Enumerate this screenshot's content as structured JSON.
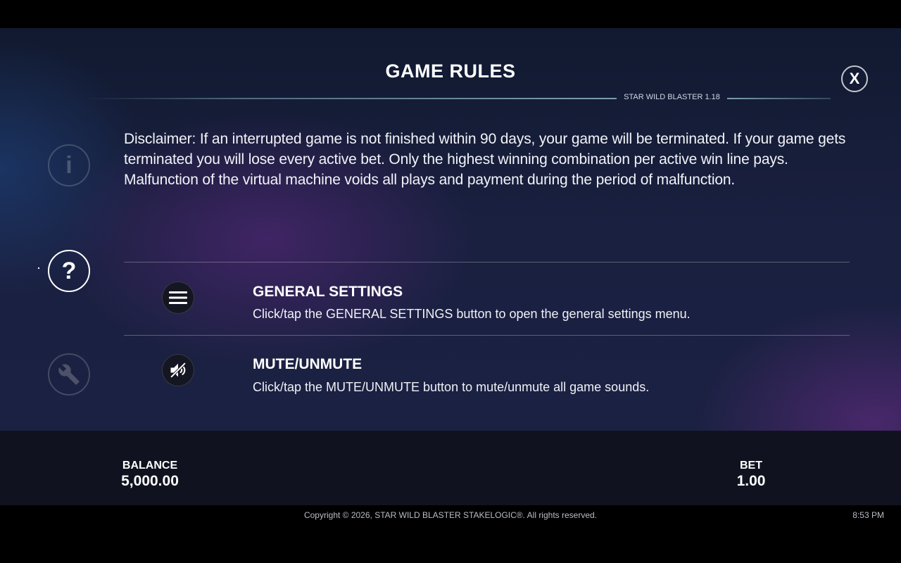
{
  "header": {
    "title": "GAME RULES",
    "version": "STAR WILD BLASTER 1.18",
    "close_label": "X"
  },
  "sidebar": {
    "items": [
      {
        "name": "info",
        "glyph": "i",
        "active": false
      },
      {
        "name": "help",
        "glyph": "?",
        "active": true
      },
      {
        "name": "tools",
        "glyph": "wrench-icon",
        "active": false
      }
    ]
  },
  "content": {
    "disclaimer": "Disclaimer: If an interrupted game is not finished within 90 days, your game will be terminated. If your game gets terminated you will lose every active bet. Only the highest winning combination per active win line pays. Malfunction of the virtual machine voids all plays and payment during the period of malfunction.",
    "settings": [
      {
        "icon": "menu-icon",
        "title": "GENERAL SETTINGS",
        "description": "Click/tap the GENERAL SETTINGS button to open the general settings menu."
      },
      {
        "icon": "mute-icon",
        "title": "MUTE/UNMUTE",
        "description": "Click/tap the MUTE/UNMUTE button to mute/unmute all game sounds."
      }
    ]
  },
  "status_bar": {
    "balance_label": "BALANCE",
    "balance_value": "5,000.00",
    "bet_label": "BET",
    "bet_value": "1.00"
  },
  "footer": {
    "copyright": "Copyright © 2026, STAR WILD BLASTER STAKELOGIC®. All rights reserved.",
    "time": "8:53 PM"
  },
  "colors": {
    "panel_bg": "#1a2040",
    "bottom_bar_bg": "#10131f",
    "accent_line": "#96bec8"
  }
}
